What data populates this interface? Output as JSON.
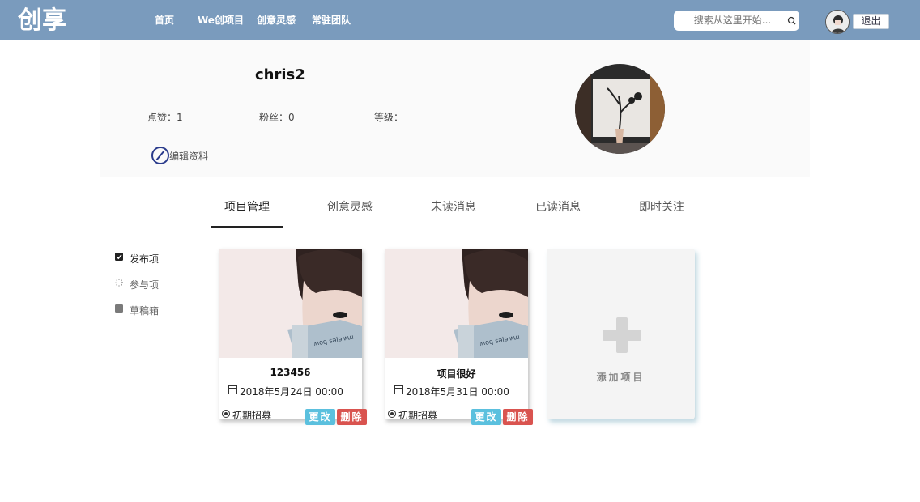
{
  "nav": {
    "logo_text": "创享",
    "links": [
      "首页",
      "We创项目",
      "创意灵感",
      "常驻团队"
    ],
    "search_placeholder": "搜索从这里开始...",
    "logout_label": "退出"
  },
  "profile": {
    "username": "chris2",
    "likes_label": "点赞：1",
    "fans_label": "粉丝：0",
    "level_label": "等级：",
    "edit_label": "编辑资料"
  },
  "tabs": [
    {
      "label": "项目管理",
      "active": true
    },
    {
      "label": "创意灵感",
      "active": false
    },
    {
      "label": "未读消息",
      "active": false
    },
    {
      "label": "已读消息",
      "active": false
    },
    {
      "label": "即时关注",
      "active": false
    }
  ],
  "filters": [
    {
      "label": "发布项",
      "icon": "checkbox-checked-icon"
    },
    {
      "label": "参与项",
      "icon": "spinner-icon"
    },
    {
      "label": "草稿箱",
      "icon": "square-icon"
    }
  ],
  "projects": [
    {
      "title": "123456",
      "date": "2018年5月24日 00:00",
      "stage": "初期招募",
      "edit_label": "更改",
      "delete_label": "删除"
    },
    {
      "title": "项目很好",
      "date": "2018年5月31日 00:00",
      "stage": "初期招募",
      "edit_label": "更改",
      "delete_label": "删除"
    }
  ],
  "add_project_label": "添加项目",
  "colors": {
    "topbar": "#7a9bbd",
    "edit_button": "#5bc0de",
    "delete_button": "#d9534f"
  }
}
